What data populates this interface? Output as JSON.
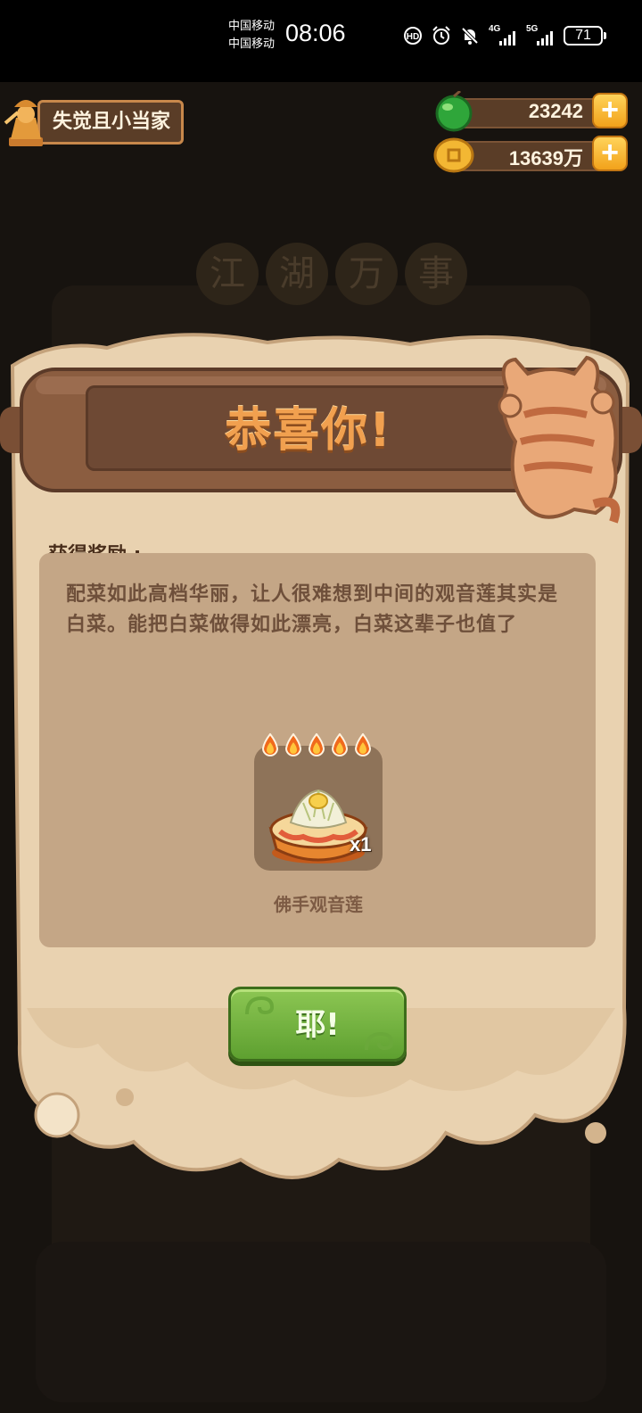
{
  "status_bar": {
    "carrier_1": "中国移动",
    "carrier_2": "中国移动",
    "time": "08:06",
    "net_1": "4G",
    "net_2": "5G",
    "battery": "71",
    "icons": [
      "hd-call-icon",
      "alarm-icon",
      "mute-icon",
      "signal-icon",
      "battery-icon"
    ]
  },
  "background": {
    "title_chars": [
      "江",
      "湖",
      "万",
      "事"
    ]
  },
  "top_bar": {
    "player_name": "失觉且小当家",
    "jade_amount": "23242",
    "coin_amount": "13639万",
    "plus_symbol": "+"
  },
  "dialog": {
    "title": "恭喜你!",
    "reward_label": "获得奖励 :",
    "description": "配菜如此高档华丽，让人很难想到中间的观音莲其实是白菜。能把白菜做得如此漂亮，白菜这辈子也值了",
    "item": {
      "name": "佛手观音莲",
      "quantity": "x1",
      "flames": 5
    },
    "confirm_button": "耶!"
  },
  "colors": {
    "parchment": "#e9d2b0",
    "panel": "#c4a686",
    "title_orange": "#f1a04f",
    "button_green": "#7ab545",
    "resource_bar": "#5a3d27"
  }
}
